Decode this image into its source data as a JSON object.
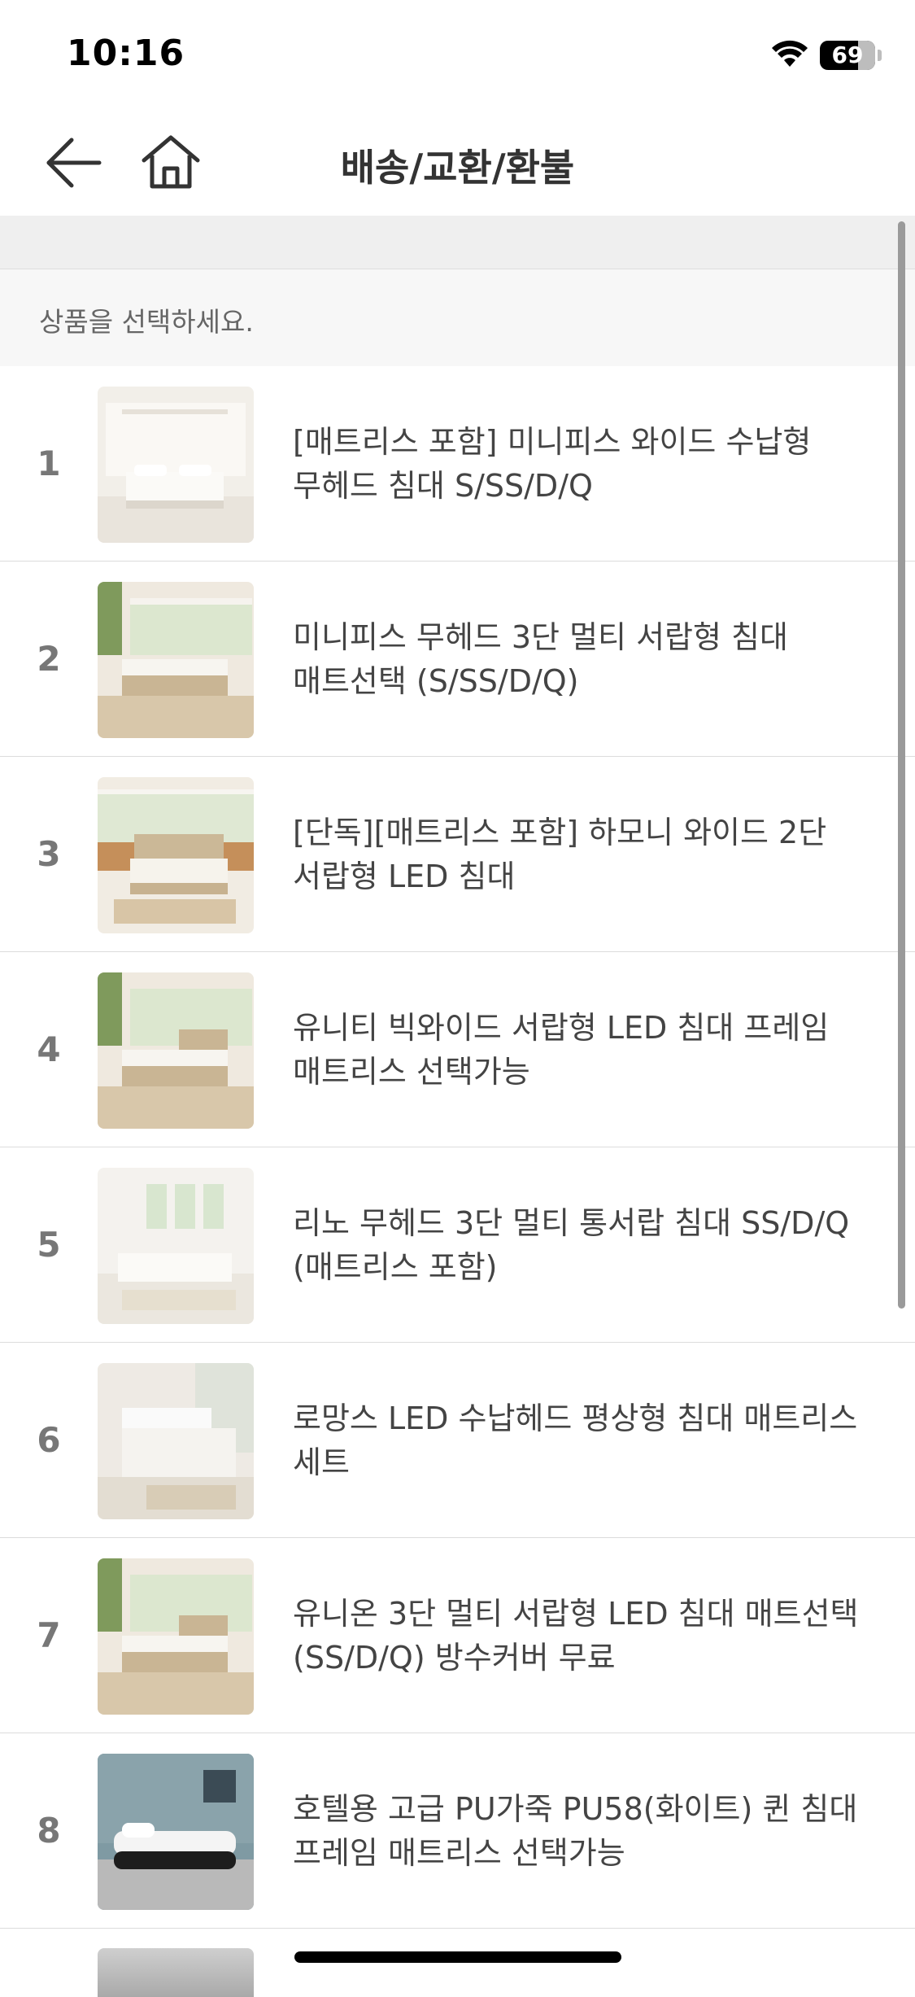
{
  "status_bar": {
    "time": "10:16",
    "battery": "69",
    "battery_level": 0.69
  },
  "header": {
    "title": "배송/교환/환불",
    "back_icon": "back-arrow-icon",
    "home_icon": "home-icon"
  },
  "instruction": "상품을 선택하세요.",
  "products": [
    {
      "num": "1",
      "name": "[매트리스 포함] 미니피스 와이드 수납형 무헤드 침대 S/SS/D/Q"
    },
    {
      "num": "2",
      "name": "미니피스 무헤드 3단 멀티 서랍형 침대 매트선택 (S/SS/D/Q)"
    },
    {
      "num": "3",
      "name": "[단독][매트리스 포함] 하모니 와이드 2단 서랍형 LED 침대"
    },
    {
      "num": "4",
      "name": "유니티 빅와이드 서랍형 LED 침대 프레임 매트리스 선택가능"
    },
    {
      "num": "5",
      "name": "리노 무헤드 3단 멀티 통서랍 침대 SS/D/Q (매트리스 포함)"
    },
    {
      "num": "6",
      "name": "로망스 LED 수납헤드 평상형 침대 매트리스 세트"
    },
    {
      "num": "7",
      "name": "유니온 3단 멀티 서랍형 LED 침대 매트선택 (SS/D/Q) 방수커버 무료"
    },
    {
      "num": "8",
      "name": "호텔용 고급 PU가죽 PU58(화이트) 퀸 침대 프레임 매트리스 선택가능"
    }
  ]
}
